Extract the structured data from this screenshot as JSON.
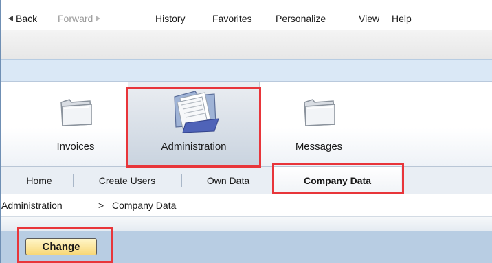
{
  "menu": {
    "back": "Back",
    "forward": "Forward",
    "history": "History",
    "favorites": "Favorites",
    "personalize": "Personalize",
    "view": "View",
    "help": "Help"
  },
  "nav": {
    "items": [
      {
        "label": "Invoices",
        "icon": "folder-icon",
        "selected": false
      },
      {
        "label": "Administration",
        "icon": "documents-icon",
        "selected": true
      },
      {
        "label": "Messages",
        "icon": "folder-icon",
        "selected": false
      }
    ]
  },
  "tabs": {
    "items": [
      {
        "label": "Home",
        "selected": false
      },
      {
        "label": "Create Users",
        "selected": false
      },
      {
        "label": "Own Data",
        "selected": false
      },
      {
        "label": "Company Data",
        "selected": true
      }
    ]
  },
  "breadcrumb": {
    "parent": "Administration",
    "separator": ">",
    "current": "Company Data"
  },
  "actions": {
    "change_label": "Change"
  },
  "colors": {
    "highlight": "#e8353a",
    "action_bar": "#b8cde3",
    "button_face": "#f8d777"
  }
}
